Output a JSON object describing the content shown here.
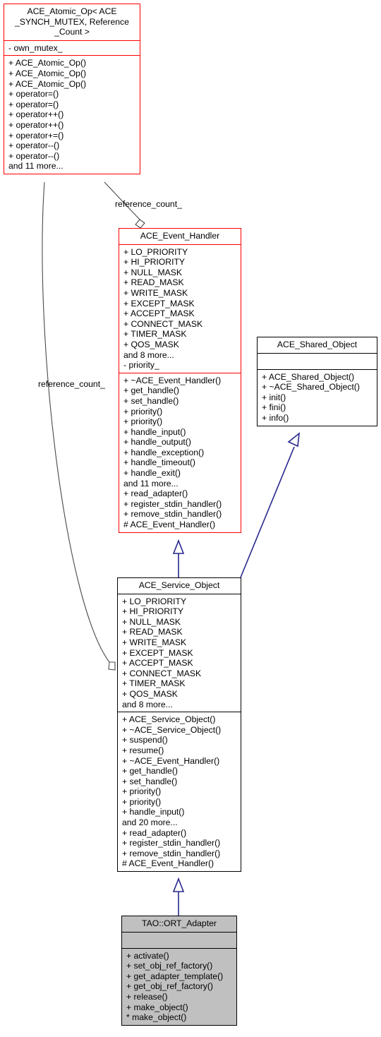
{
  "diagram": {
    "kind": "uml-class-diagram",
    "colors": {
      "highlight_border": "#ff0000",
      "normal_border": "#000000",
      "inheritance_edge": "#27288c",
      "association_edge": "#4a4a4a",
      "node_fill": "#ffffff",
      "focus_node_fill": "#c0c0c0"
    },
    "classes": [
      {
        "id": "ace_atomic_op",
        "name": "ACE_Atomic_Op< ACE\n_SYNCH_MUTEX, Reference\n_Count >",
        "attributes": [
          "- own_mutex_"
        ],
        "operations": [
          "+ ACE_Atomic_Op()",
          "+ ACE_Atomic_Op()",
          "+ ACE_Atomic_Op()",
          "+ operator=()",
          "+ operator=()",
          "+ operator++()",
          "+ operator++()",
          "+ operator+=()",
          "+ operator--()",
          "+ operator--()",
          "and 11 more..."
        ]
      },
      {
        "id": "ace_event_handler",
        "name": "ACE_Event_Handler",
        "attributes": [
          "+ LO_PRIORITY",
          "+ HI_PRIORITY",
          "+ NULL_MASK",
          "+ READ_MASK",
          "+ WRITE_MASK",
          "+ EXCEPT_MASK",
          "+ ACCEPT_MASK",
          "+ CONNECT_MASK",
          "+ TIMER_MASK",
          "+ QOS_MASK",
          "and 8 more...",
          "- priority_"
        ],
        "operations": [
          "+ ~ACE_Event_Handler()",
          "+ get_handle()",
          "+ set_handle()",
          "+ priority()",
          "+ priority()",
          "+ handle_input()",
          "+ handle_output()",
          "+ handle_exception()",
          "+ handle_timeout()",
          "+ handle_exit()",
          "and 11 more...",
          "+ read_adapter()",
          "+ register_stdin_handler()",
          "+ remove_stdin_handler()",
          "# ACE_Event_Handler()"
        ]
      },
      {
        "id": "ace_shared_object",
        "name": "ACE_Shared_Object",
        "attributes": [],
        "operations": [
          "+ ACE_Shared_Object()",
          "+ ~ACE_Shared_Object()",
          "+ init()",
          "+ fini()",
          "+ info()"
        ]
      },
      {
        "id": "ace_service_object",
        "name": "ACE_Service_Object",
        "attributes": [
          "+ LO_PRIORITY",
          "+ HI_PRIORITY",
          "+ NULL_MASK",
          "+ READ_MASK",
          "+ WRITE_MASK",
          "+ EXCEPT_MASK",
          "+ ACCEPT_MASK",
          "+ CONNECT_MASK",
          "+ TIMER_MASK",
          "+ QOS_MASK",
          "and 8 more..."
        ],
        "operations": [
          "+ ACE_Service_Object()",
          "+ ~ACE_Service_Object()",
          "+ suspend()",
          "+ resume()",
          "+ ~ACE_Event_Handler()",
          "+ get_handle()",
          "+ set_handle()",
          "+ priority()",
          "+ priority()",
          "+ handle_input()",
          "and 20 more...",
          "+ read_adapter()",
          "+ register_stdin_handler()",
          "+ remove_stdin_handler()",
          "# ACE_Event_Handler()"
        ]
      },
      {
        "id": "tao_ort_adapter",
        "name": "TAO::ORT_Adapter",
        "attributes": [],
        "operations": [
          "+ activate()",
          "+ set_obj_ref_factory()",
          "+ get_adapter_template()",
          "+ get_obj_ref_factory()",
          "+ release()",
          "+ make_object()",
          "* make_object()"
        ]
      }
    ],
    "edges": [
      {
        "id": "edge_atomic_to_event_handler",
        "type": "aggregation",
        "from": "ace_atomic_op",
        "to": "ace_event_handler",
        "label": "reference_count_"
      },
      {
        "id": "edge_atomic_to_service_object",
        "type": "aggregation",
        "from": "ace_atomic_op",
        "to": "ace_service_object",
        "label": "reference_count_"
      },
      {
        "id": "edge_event_handler_to_service_object",
        "type": "inheritance",
        "from": "ace_service_object",
        "to": "ace_event_handler",
        "label": ""
      },
      {
        "id": "edge_shared_object_to_service_object",
        "type": "inheritance",
        "from": "ace_service_object",
        "to": "ace_shared_object",
        "label": ""
      },
      {
        "id": "edge_service_object_to_ort_adapter",
        "type": "inheritance",
        "from": "tao_ort_adapter",
        "to": "ace_service_object",
        "label": ""
      }
    ]
  }
}
